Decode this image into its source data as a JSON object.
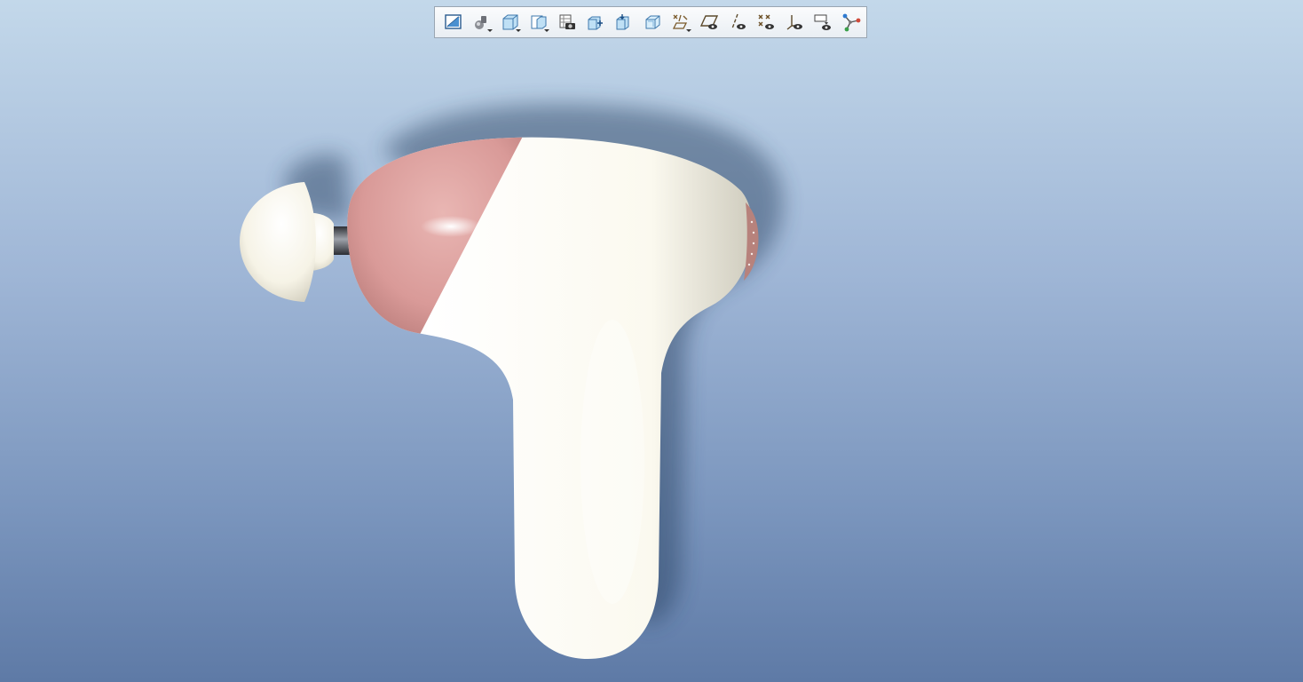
{
  "toolbar": {
    "items": [
      {
        "icon": "refit-icon"
      },
      {
        "icon": "display-style-icon"
      },
      {
        "icon": "saved-orientations-icon"
      },
      {
        "icon": "view-manager-icon"
      },
      {
        "icon": "perspective-view-icon"
      },
      {
        "icon": "zoom-in-icon"
      },
      {
        "icon": "zoom-out-icon"
      },
      {
        "icon": "appearance-icon"
      },
      {
        "icon": "datum-display-filters-icon"
      },
      {
        "icon": "plane-display-icon"
      },
      {
        "icon": "axis-display-icon"
      },
      {
        "icon": "point-display-icon"
      },
      {
        "icon": "csys-display-icon"
      },
      {
        "icon": "annotation-display-icon"
      },
      {
        "icon": "spin-center-icon"
      }
    ]
  },
  "colors": {
    "body_white": "#fbf9ef",
    "nose_pink": "#d99a98",
    "shaft_gray": "#5d6068",
    "accent_red": "#d04a3a"
  }
}
